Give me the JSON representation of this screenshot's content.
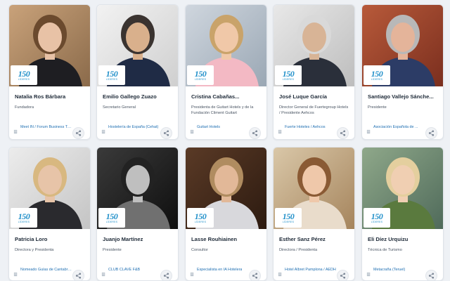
{
  "badge": {
    "number": "150",
    "caption": "LÍDERES"
  },
  "cards": [
    {
      "name": "Natalia Ros Bárbara",
      "role": "Fundadora",
      "org": "Meet IN / Forum Business Travel ..."
    },
    {
      "name": "Emilio Gallego Zuazo",
      "role": "Secretario General",
      "org": "Hostelería de España (Cehat)"
    },
    {
      "name": "Cristina Cabañas...",
      "role": "Presidenta de Guitart Hotels y de la Fundación Climent Guitart",
      "org": "Guitart Hotels"
    },
    {
      "name": "José Luque García",
      "role": "Director General de Fuertegroup Hotels / Presidente Aehcos",
      "org": "Fuerte Hoteles / Aehcos"
    },
    {
      "name": "Santiago Vallejo Sánche...",
      "role": "Presidente",
      "org": "Asociación Española de ..."
    },
    {
      "name": "Patricia Loro",
      "role": "Directora y Presidenta",
      "org": "Nomeado Guías de Cantabria / ..."
    },
    {
      "name": "Juanjo Martínez",
      "role": "Presidente",
      "org": "CLUB CLAVE F&B"
    },
    {
      "name": "Lasse Rouhiainen",
      "role": "Consultor",
      "org": "Especialista en IA Hotelera"
    },
    {
      "name": "Esther Sanz Pérez",
      "role": "Directora / Presidenta",
      "org": "Hotel Albret Pamplona / AEDH"
    },
    {
      "name": "Eli Díez Urquizu",
      "role": "Técnica de Turismo",
      "org": "Metacraña (Teruel)"
    }
  ]
}
